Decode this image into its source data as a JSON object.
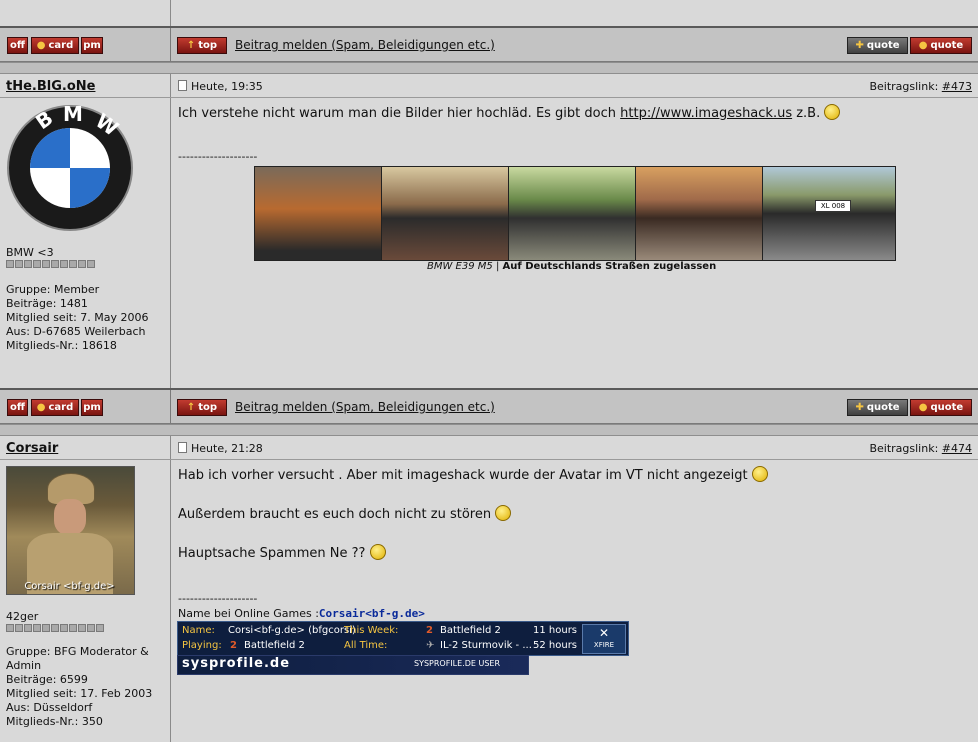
{
  "post_actions": {
    "off_label": "off",
    "card_label": "card",
    "pm_label": "pm",
    "top_label": "top",
    "report_label": "Beitrag melden (Spam, Beleidigungen etc.)",
    "quote_add_label": "quote",
    "quote_label": "quote"
  },
  "posts": [
    {
      "username": "tHe.BlG.oNe",
      "time": "Heute, 19:35",
      "postlink_prefix": "Beitragslink:",
      "postlink": "#473",
      "rank": "BMW <3",
      "group": "Gruppe: Member",
      "posts": "Beiträge: 1481",
      "member_since": "Mitglied seit: 7. May 2006",
      "from": "Aus: D-67685 Weilerbach",
      "member_no": "Mitglieds-Nr.: 18618",
      "message_pre": "Ich verstehe nicht warum man die Bilder hier hochläd. Es gibt doch ",
      "message_link": "http://www.imageshack.us",
      "message_post": " z.B.",
      "divider": "--------------------",
      "sig_caption_italic": "BMW E39 M5",
      "sig_caption_sep": "|",
      "sig_caption_bold": "Auf Deutschlands Straßen zugelassen",
      "plate": "XL 008"
    },
    {
      "username": "Corsair",
      "time": "Heute, 21:28",
      "postlink_prefix": "Beitragslink:",
      "postlink": "#474",
      "avatar_caption": "Corsair <bf-g.de>",
      "rank": "42ger",
      "group_line1": "Gruppe: BFG Moderator &",
      "group_line2": "Admin",
      "posts": "Beiträge: 6599",
      "member_since": "Mitglied seit: 17. Feb 2003",
      "from": "Aus: Düsseldorf",
      "member_no": "Mitglieds-Nr.: 350",
      "line1": "Hab ich vorher versucht . Aber mit imageshack wurde der Avatar im VT nicht angezeigt",
      "line2": "Außerdem braucht es euch doch nicht zu stören",
      "line3": "Hauptsache Spammen Ne ??",
      "divider": "--------------------",
      "games_label": "Name bei Online Games :",
      "games_name": "Corsair<bf-g.de>",
      "xfire": {
        "name_label": "Name:",
        "name_value": "Corsi<bf-g.de> (bfgcorsi)",
        "week_label": "This Week:",
        "week_game": "Battlefield 2",
        "week_hours": "11 hours",
        "playing_label": "Playing:",
        "playing_value": "Battlefield 2",
        "alltime_label": "All Time:",
        "alltime_game": "IL-2 Sturmovik - ...",
        "alltime_hours": "52 hours",
        "logo": "XFIRE",
        "brand": "sysprofile.de",
        "brand_user": "SYSPROFILE.DE  USER"
      }
    }
  ]
}
